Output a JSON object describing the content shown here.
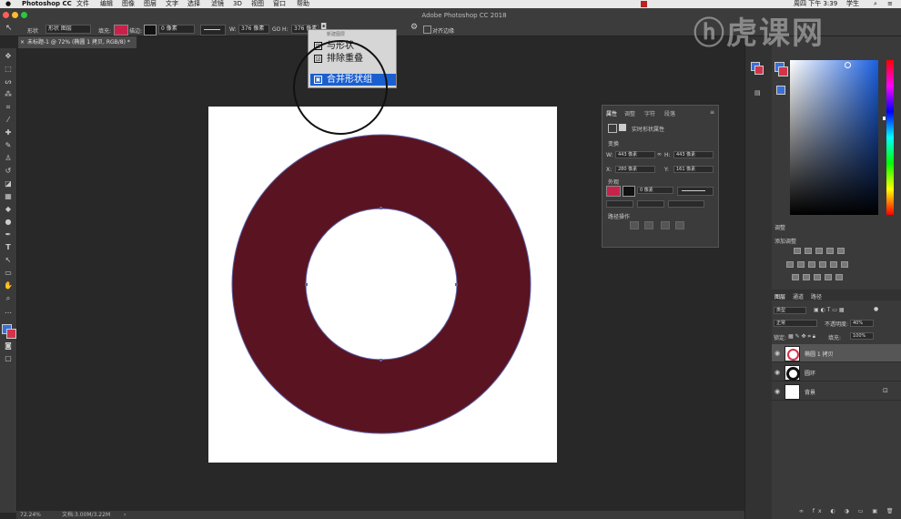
{
  "menubar": {
    "app": "Photoshop CC",
    "menus": [
      "文件",
      "编辑",
      "图像",
      "图层",
      "文字",
      "选择",
      "滤镜",
      "3D",
      "视图",
      "窗口",
      "帮助"
    ],
    "clock": "周四 下午 3:39",
    "user": "学生"
  },
  "app_title": "Adobe Photoshop CC 2018",
  "options_bar": {
    "mode_label": "形状",
    "mode_value": "形状 图层",
    "fill_label": "填充:",
    "fill_color": "#c8224a",
    "stroke_label": "描边:",
    "stroke_width": "0 像素",
    "w_label": "W:",
    "w_value": "376 像素",
    "go_label": "GO",
    "h_label": "H:",
    "h_value": "376 像素",
    "align_edges": "对齐边缘"
  },
  "doc_tab": "未标题-1 @ 72% (椭圆 1 拷贝, RGB/8) *",
  "dropdown": {
    "header": "新建图层",
    "items": [
      {
        "label": "与形状",
        "icon": "intersect-shape-icon",
        "highlighted": false
      },
      {
        "label": "排除重叠",
        "icon": "exclude-overlap-icon",
        "highlighted": false
      },
      {
        "label": "合并形状组",
        "icon": "merge-shape-icon",
        "highlighted": true
      }
    ]
  },
  "shape": {
    "fill_color": "#5a1320",
    "stroke_color": "#5b62a8"
  },
  "properties_panel": {
    "tabs": [
      "属性",
      "调整",
      "字符",
      "段落"
    ],
    "subtitle": "实时形状属性",
    "transform_label": "变换",
    "w_label": "W:",
    "w_value": "443 像素",
    "h_label": "H:",
    "h_value": "443 像素",
    "x_label": "X:",
    "x_value": "280 像素",
    "y_label": "Y:",
    "y_value": "161 像素",
    "appearance_label": "外观",
    "fill_color": "#c8224a",
    "stroke_width": "0 像素",
    "path_ops_label": "路径操作"
  },
  "color_picker": {
    "hue_color": "#1a5fe0"
  },
  "adjustments": {
    "tab": "调整",
    "title": "添加调整"
  },
  "layers_panel": {
    "tabs": [
      "图层",
      "通道",
      "路径"
    ],
    "kind_label": "类型",
    "blend_mode": "正常",
    "opacity_label": "不透明度:",
    "opacity_value": "40%",
    "lock_label": "锁定:",
    "fill_label": "填充:",
    "fill_value": "100%",
    "layers": [
      {
        "name": "椭圆 1 拷贝",
        "selected": true
      },
      {
        "name": "圆环",
        "selected": false
      },
      {
        "name": "背景",
        "selected": false
      }
    ]
  },
  "status_bar": {
    "zoom": "72.24%",
    "doc_info": "文档:3.00M/3.22M"
  },
  "watermark": "虎课网"
}
